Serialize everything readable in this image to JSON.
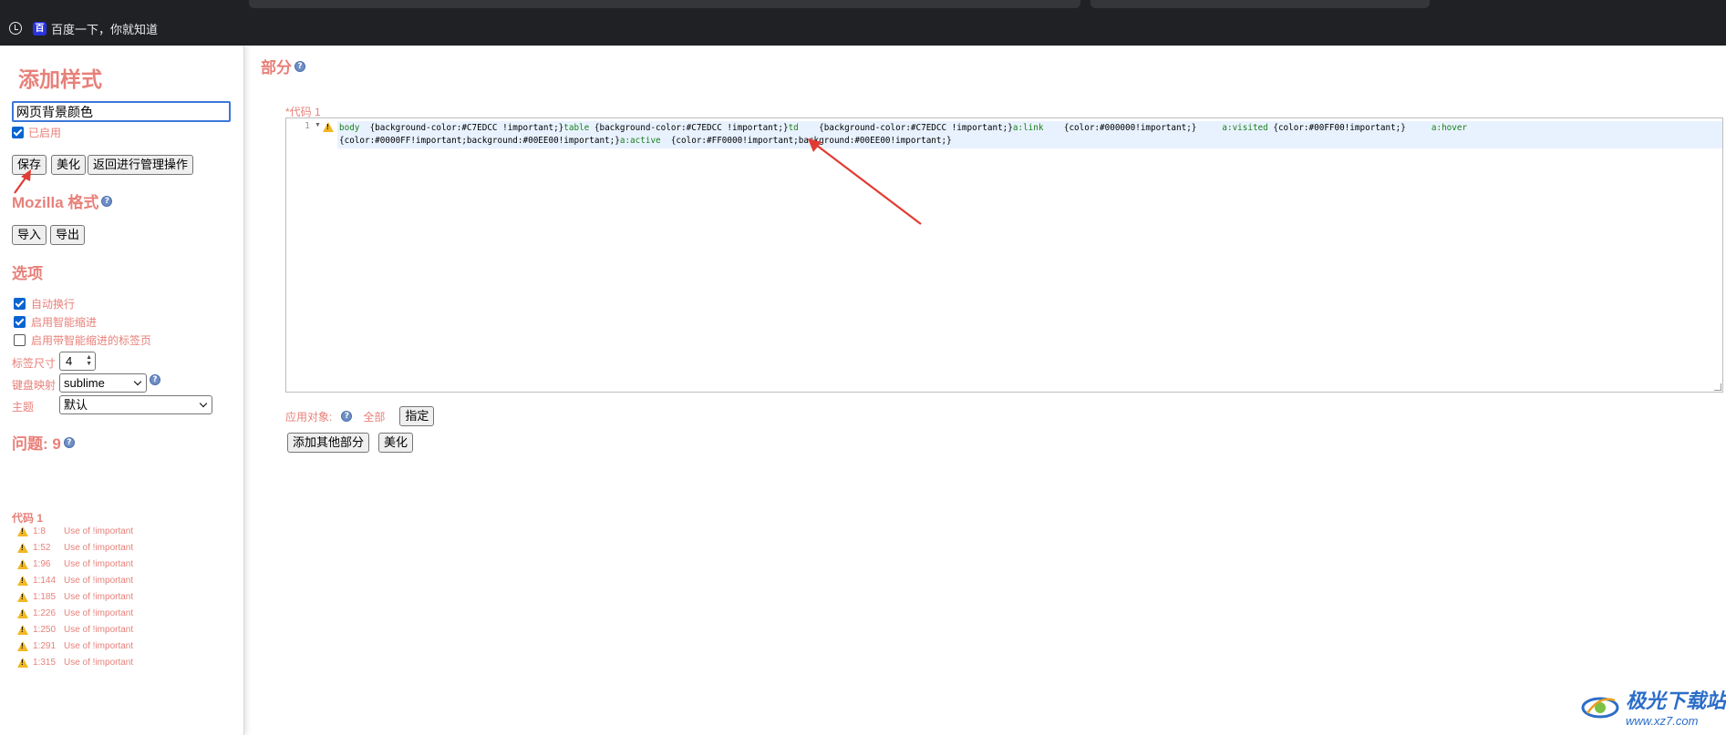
{
  "bookmarks": {
    "item1_label": "百度一下，你就知道"
  },
  "sidebar": {
    "title": "添加样式",
    "name_value": "网页背景颜色",
    "enabled_label": "已启用",
    "buttons": {
      "save": "保存",
      "beautify": "美化",
      "back": "返回进行管理操作"
    },
    "mozilla": {
      "title": "Mozilla 格式",
      "import": "导入",
      "export": "导出"
    },
    "options": {
      "title": "选项",
      "auto_wrap": "自动换行",
      "smart_indent": "启用智能缩进",
      "tab_smart": "启用带智能缩进的标签页",
      "tab_size_label": "标签尺寸",
      "tab_size_value": "4",
      "keymap_label": "键盘映射",
      "keymap_value": "sublime",
      "theme_label": "主题",
      "theme_value": "默认"
    },
    "issues": {
      "title": "问题: 9",
      "section": "代码 1",
      "items": [
        {
          "pos": "1:8",
          "msg": "Use of !important"
        },
        {
          "pos": "1:52",
          "msg": "Use of !important"
        },
        {
          "pos": "1:96",
          "msg": "Use of !important"
        },
        {
          "pos": "1:144",
          "msg": "Use of !important"
        },
        {
          "pos": "1:185",
          "msg": "Use of !important"
        },
        {
          "pos": "1:226",
          "msg": "Use of !important"
        },
        {
          "pos": "1:250",
          "msg": "Use of !important"
        },
        {
          "pos": "1:291",
          "msg": "Use of !important"
        },
        {
          "pos": "1:315",
          "msg": "Use of !important"
        }
      ]
    }
  },
  "main": {
    "title": "部分",
    "code_label": "*代码 1",
    "line_number": "1",
    "code": {
      "t1": "body",
      "t2": "  {background-color:#C7EDCC !important;}",
      "t3": "table",
      "t4": " {background-color:#C7EDCC !important;}",
      "t5": "td",
      "t6": "    {background-color:#C7EDCC !important;}",
      "t7": "a:link",
      "t8": "    {color:#000000!important;}     ",
      "t9": "a:visited",
      "t10": " {color:#00FF00!important;}     ",
      "t11": "a:hover",
      "t12": "{color:#0000FF!important;background:#00EE00!important;}",
      "t13": "a:active",
      "t14": "  {color:#FF0000!important;background:#00EE00!important;}"
    },
    "apply_label": "应用对象:",
    "apply_all": "全部",
    "apply_specify": "指定",
    "add_section": "添加其他部分",
    "beautify": "美化"
  },
  "watermark": {
    "name": "极光下载站",
    "url": "www.xz7.com"
  },
  "colors": {
    "accent": "#e8807a",
    "annotation_arrow": "#e23b32",
    "checkbox": "#0a64d0"
  }
}
